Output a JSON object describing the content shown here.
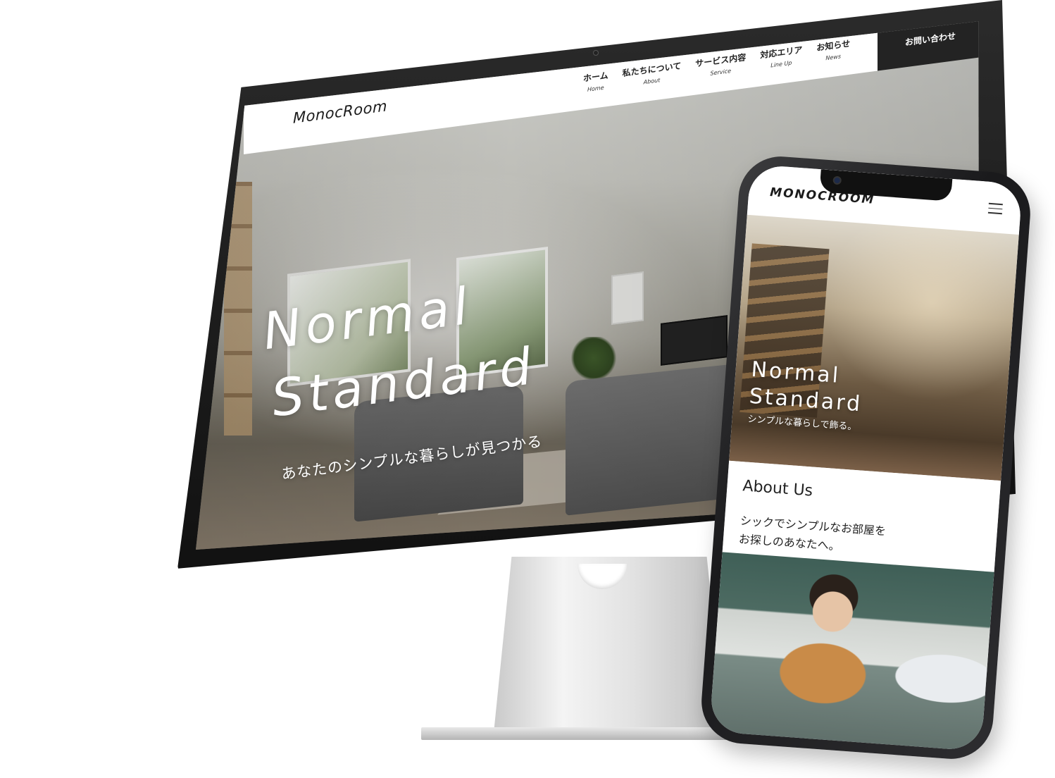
{
  "desktop": {
    "brand": "MonocRoom",
    "nav": [
      {
        "ja": "ホーム",
        "en": "Home"
      },
      {
        "ja": "私たちについて",
        "en": "About"
      },
      {
        "ja": "サービス内容",
        "en": "Service"
      },
      {
        "ja": "対応エリア",
        "en": "Line Up"
      },
      {
        "ja": "お知らせ",
        "en": "News"
      }
    ],
    "cta": "お問い合わせ",
    "hero": {
      "title_line1": "Normal",
      "title_line2": "Standard",
      "subtitle": "あなたのシンプルな暮らしが見つかる"
    }
  },
  "mobile": {
    "brand": "MONOCROOM",
    "hero": {
      "title_line1": "Normal",
      "title_line2": "Standard",
      "subtitle": "シンプルな暮らしで飾る。"
    },
    "about": {
      "title": "About Us",
      "text_line1": "シックでシンプルなお部屋を",
      "text_line2": "お探しのあなたへ。"
    }
  }
}
